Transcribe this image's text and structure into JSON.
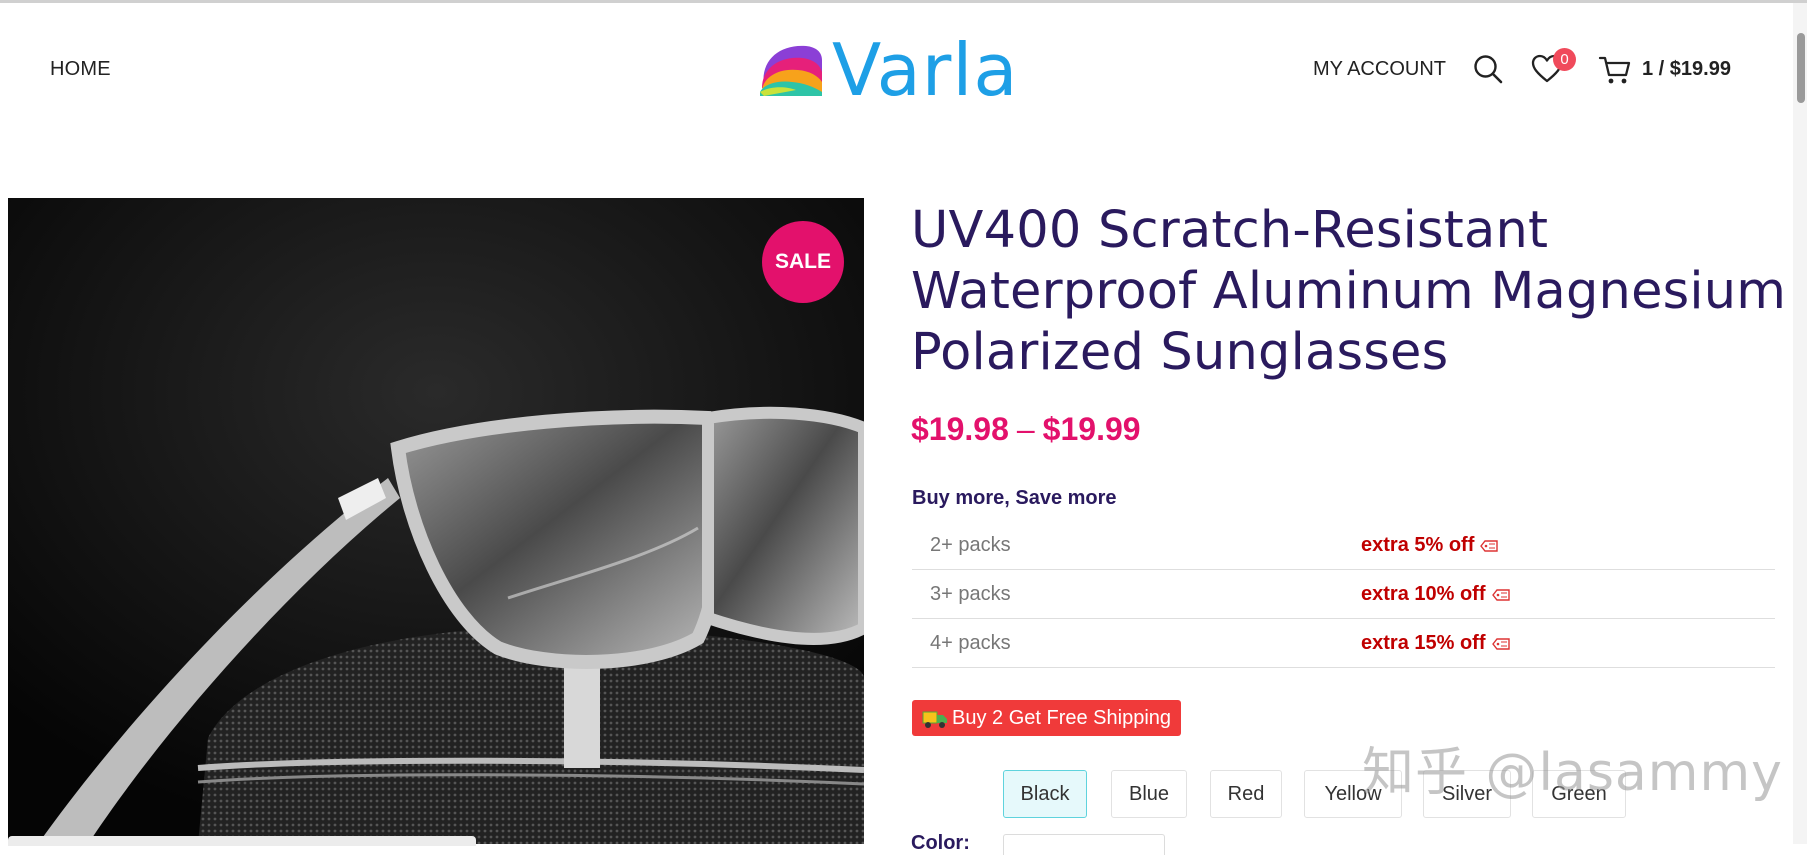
{
  "header": {
    "nav_home": "HOME",
    "logo_text": "Varla",
    "my_account": "MY ACCOUNT",
    "wishlist_count": "0",
    "cart_summary": "1 / $19.99"
  },
  "product": {
    "sale_badge": "SALE",
    "title": "UV400 Scratch-Resistant Waterproof Aluminum Magnesium Polarized Sunglasses",
    "price_low": "$19.98",
    "price_sep": "–",
    "price_high": "$19.99",
    "bulk_heading": "Buy more, Save more",
    "bulk_rows": [
      {
        "packs": "2+ packs",
        "discount": "extra 5% off"
      },
      {
        "packs": "3+ packs",
        "discount": "extra 10% off"
      },
      {
        "packs": "4+ packs",
        "discount": "extra 15% off"
      }
    ],
    "shipping_badge": "Buy 2 Get Free Shipping",
    "colors": [
      "Black",
      "Blue",
      "Red",
      "Yellow",
      "Silver",
      "Green"
    ],
    "selected_color": "Black",
    "color_label": "Color:"
  },
  "watermark": "知乎 @lasammy",
  "colors": {
    "title": "#2a1a5e",
    "price": "#e3116c",
    "discount": "#c00000",
    "logo": "#1e9fe6",
    "shipping": "#f03a3a"
  }
}
